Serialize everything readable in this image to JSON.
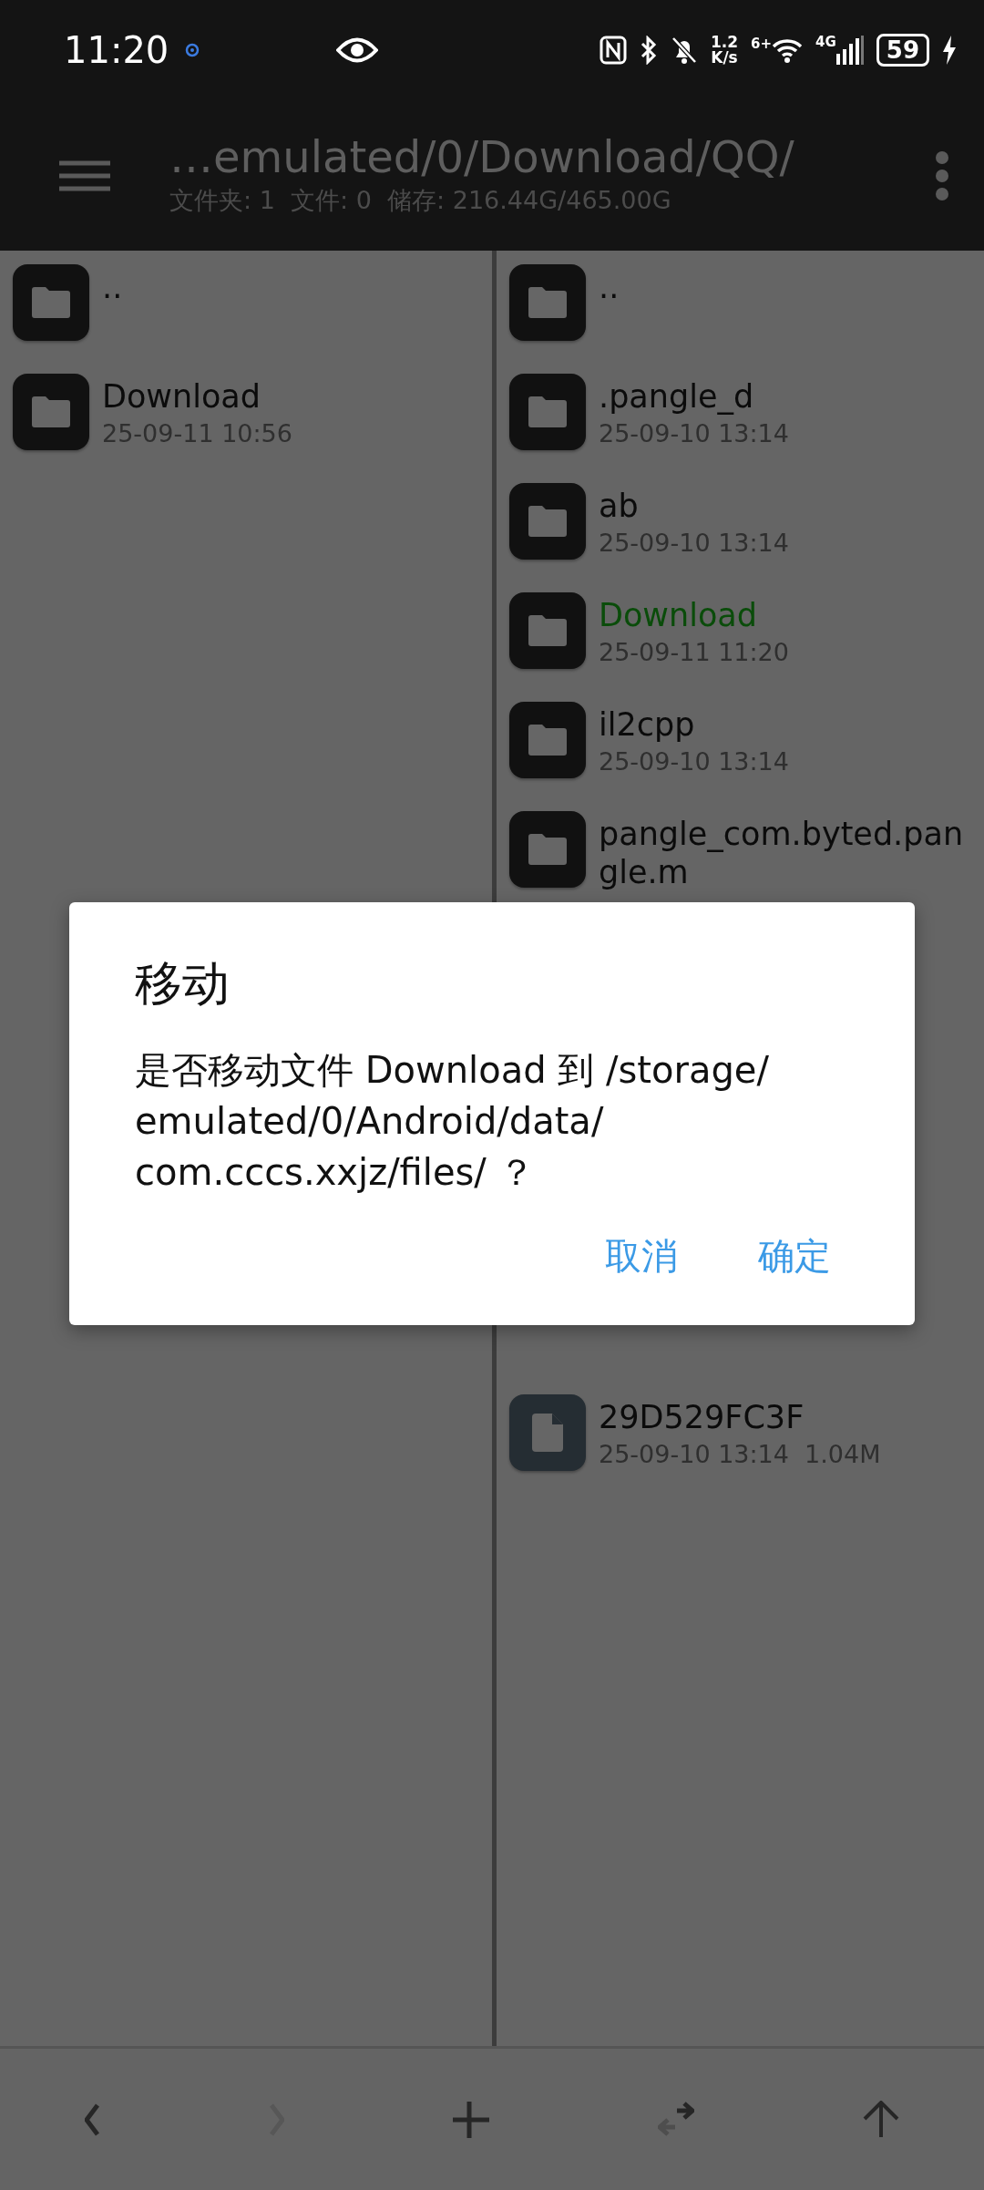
{
  "status_bar": {
    "time": "11:20",
    "speed_value": "1.2",
    "speed_unit": "K/s",
    "wifi_label": "6+",
    "cellular_label": "4G",
    "battery": "59"
  },
  "header": {
    "path": "…emulated/0/Download/QQ/",
    "summary": "文件夹: 1  文件: 0  储存: 216.44G/465.00G"
  },
  "left_pane": {
    "items": [
      {
        "kind": "folder",
        "name": "..",
        "highlighted": false
      },
      {
        "kind": "folder",
        "name": "Download",
        "date": "25-09-11 10:56",
        "highlighted": false
      }
    ]
  },
  "right_pane": {
    "items": [
      {
        "kind": "folder",
        "name": "..",
        "highlighted": false
      },
      {
        "kind": "folder",
        "name": ".pangle_d",
        "date": "25-09-10 13:14",
        "highlighted": false
      },
      {
        "kind": "folder",
        "name": "ab",
        "date": "25-09-10 13:14",
        "highlighted": false
      },
      {
        "kind": "folder",
        "name": "Download",
        "date": "25-09-11 11:20",
        "highlighted": true
      },
      {
        "kind": "folder",
        "name": "il2cpp",
        "date": "25-09-10 13:14",
        "highlighted": false
      },
      {
        "kind": "folder",
        "name": "pangle_com.byted.pangle.m",
        "highlighted": false
      },
      {
        "kind": "file",
        "name": "29D529FC3F",
        "date": "25-09-10 13:14",
        "size": "1.04M",
        "highlighted": false
      }
    ]
  },
  "dialog": {
    "title": "移动",
    "message": "是否移动文件 Download 到 /storage/emulated/0/Android/data/com.cccs.xxjz/files/ ？",
    "buttons": [
      "取消",
      "确定"
    ]
  },
  "toolbar": [
    {
      "kind": "back",
      "disabled": false
    },
    {
      "kind": "forward",
      "disabled": true
    },
    {
      "kind": "add",
      "disabled": false
    },
    {
      "kind": "swap",
      "disabled": false
    },
    {
      "kind": "up",
      "disabled": false
    }
  ]
}
